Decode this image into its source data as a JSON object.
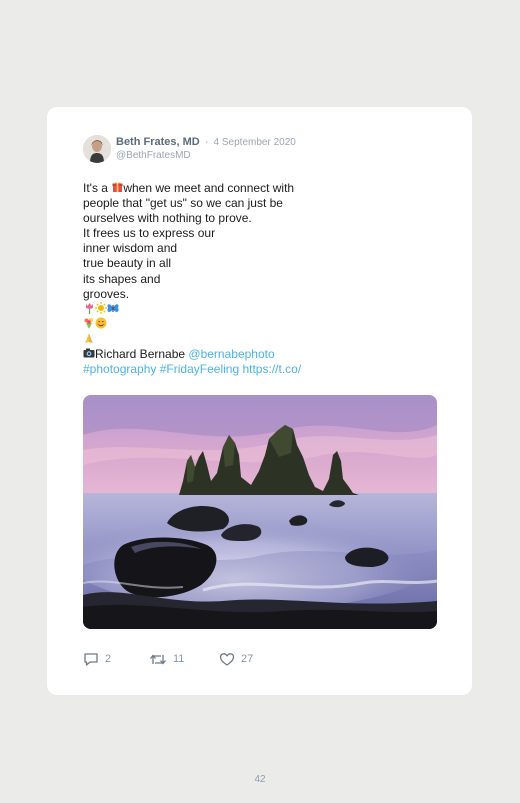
{
  "tweet": {
    "author_name": "Beth Frates, MD",
    "separator": "·",
    "date": "4 September 2020",
    "handle": "@BethFratesMD",
    "lines": {
      "l1a": "It's a ",
      "l1b": "when we meet and connect with",
      "l2": "people that \"get us\" so we can just be",
      "l3": "ourselves with nothing to prove.",
      "l4": "It frees us to express our",
      "l5": "inner wisdom and",
      "l6": "true beauty in all",
      "l7": "its shapes and",
      "l8": "grooves.",
      "credit_name": "Richard Bernabe ",
      "credit_handle": "@bernabephoto",
      "hashtag1": "#photography",
      "hashtag2": "#FridayFeeling",
      "url": "https://t.co/"
    },
    "emojis": [
      "gift",
      "tulip",
      "sun",
      "butterfly",
      "bouquet",
      "smiling-face",
      "folded-hands",
      "camera"
    ],
    "image_alt": "Sea stacks rising from a misty ocean at a black sand beach under a pink sunset sky",
    "stats": {
      "replies": "2",
      "retweets": "11",
      "likes": "27"
    }
  },
  "page": {
    "number": "42"
  },
  "colors": {
    "link": "#4bb3e6",
    "meta": "#9aa6b2",
    "background": "#ebebea"
  }
}
